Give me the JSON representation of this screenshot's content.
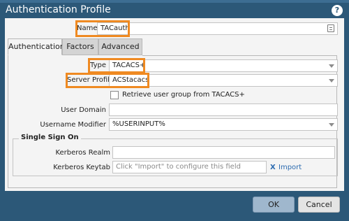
{
  "dialog": {
    "title": "Authentication Profile",
    "help_symbol": "?"
  },
  "name_field": {
    "label": "Name",
    "value": "TACauth"
  },
  "tabs": [
    {
      "label": "Authentication",
      "active": true
    },
    {
      "label": "Factors",
      "active": false
    },
    {
      "label": "Advanced",
      "active": false
    }
  ],
  "auth": {
    "type": {
      "label": "Type",
      "value": "TACACS+"
    },
    "server_profile": {
      "label": "Server Profile",
      "value": "ACStacacs"
    },
    "retrieve_group": {
      "label": "Retrieve user group from TACACS+",
      "checked": false
    },
    "user_domain": {
      "label": "User Domain",
      "value": ""
    },
    "username_modifier": {
      "label": "Username Modifier",
      "value": "%USERINPUT%"
    }
  },
  "sso": {
    "legend": "Single Sign On",
    "kerberos_realm": {
      "label": "Kerberos Realm",
      "value": ""
    },
    "kerberos_keytab": {
      "label": "Kerberos Keytab",
      "placeholder": "Click \"Import\" to configure this field",
      "clear_symbol": "X",
      "import_label": "Import"
    }
  },
  "buttons": {
    "ok": "OK",
    "cancel": "Cancel"
  },
  "colors": {
    "header": "#2c5878",
    "highlight": "#ef8a22",
    "link": "#2c6bb0"
  }
}
